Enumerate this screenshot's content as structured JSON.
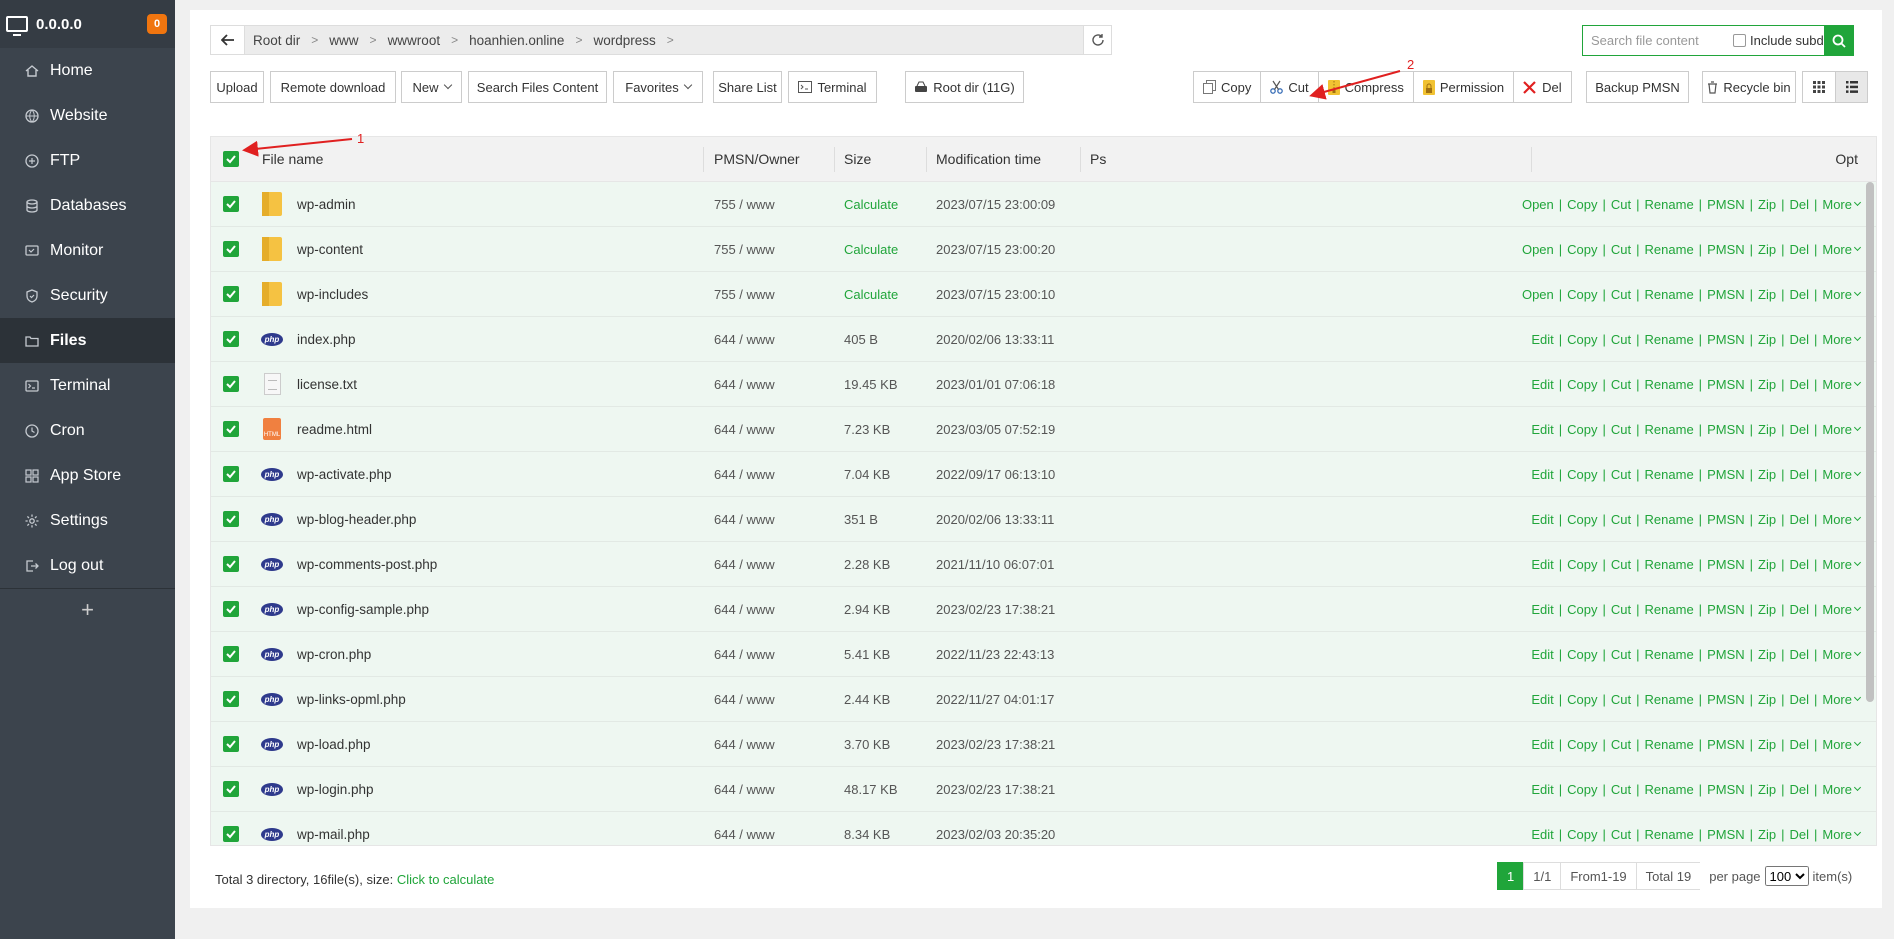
{
  "sidebar": {
    "ip": "0.0.0.0",
    "badge": "0",
    "items": [
      {
        "label": "Home",
        "icon": "home-icon"
      },
      {
        "label": "Website",
        "icon": "globe-icon"
      },
      {
        "label": "FTP",
        "icon": "ftp-icon"
      },
      {
        "label": "Databases",
        "icon": "database-icon"
      },
      {
        "label": "Monitor",
        "icon": "monitor-icon"
      },
      {
        "label": "Security",
        "icon": "shield-icon"
      },
      {
        "label": "Files",
        "icon": "folder-icon",
        "active": true
      },
      {
        "label": "Terminal",
        "icon": "terminal-icon"
      },
      {
        "label": "Cron",
        "icon": "clock-icon"
      },
      {
        "label": "App Store",
        "icon": "apps-icon"
      },
      {
        "label": "Settings",
        "icon": "gear-icon"
      },
      {
        "label": "Log out",
        "icon": "logout-icon"
      }
    ],
    "add_label": "+"
  },
  "path": {
    "crumbs": [
      "Root dir",
      "www",
      "wwwroot",
      "hoanhien.online",
      "wordpress"
    ]
  },
  "search": {
    "placeholder": "Search file content",
    "include_subdir": "Include subdir"
  },
  "toolbar": {
    "upload": "Upload",
    "remote_download": "Remote download",
    "new": "New",
    "search_files_content": "Search Files Content",
    "favorites": "Favorites",
    "share_list": "Share List",
    "terminal": "Terminal",
    "root_dir": "Root dir (11G)",
    "copy": "Copy",
    "cut": "Cut",
    "compress": "Compress",
    "permission": "Permission",
    "del": "Del",
    "backup_pmsn": "Backup PMSN",
    "recycle_bin": "Recycle bin"
  },
  "table": {
    "headers": {
      "name": "File name",
      "owner": "PMSN/Owner",
      "size": "Size",
      "mtime": "Modification time",
      "ps": "Ps",
      "opt": "Opt"
    },
    "rows": [
      {
        "name": "wp-admin",
        "type": "folder",
        "perm": "755 / www",
        "size": "Calculate",
        "mtime": "2023/07/15 23:00:09"
      },
      {
        "name": "wp-content",
        "type": "folder",
        "perm": "755 / www",
        "size": "Calculate",
        "mtime": "2023/07/15 23:00:20"
      },
      {
        "name": "wp-includes",
        "type": "folder",
        "perm": "755 / www",
        "size": "Calculate",
        "mtime": "2023/07/15 23:00:10"
      },
      {
        "name": "index.php",
        "type": "php",
        "perm": "644 / www",
        "size": "405 B",
        "mtime": "2020/02/06 13:33:11"
      },
      {
        "name": "license.txt",
        "type": "txt",
        "perm": "644 / www",
        "size": "19.45 KB",
        "mtime": "2023/01/01 07:06:18"
      },
      {
        "name": "readme.html",
        "type": "html",
        "perm": "644 / www",
        "size": "7.23 KB",
        "mtime": "2023/03/05 07:52:19"
      },
      {
        "name": "wp-activate.php",
        "type": "php",
        "perm": "644 / www",
        "size": "7.04 KB",
        "mtime": "2022/09/17 06:13:10"
      },
      {
        "name": "wp-blog-header.php",
        "type": "php",
        "perm": "644 / www",
        "size": "351 B",
        "mtime": "2020/02/06 13:33:11"
      },
      {
        "name": "wp-comments-post.php",
        "type": "php",
        "perm": "644 / www",
        "size": "2.28 KB",
        "mtime": "2021/11/10 06:07:01"
      },
      {
        "name": "wp-config-sample.php",
        "type": "php",
        "perm": "644 / www",
        "size": "2.94 KB",
        "mtime": "2023/02/23 17:38:21"
      },
      {
        "name": "wp-cron.php",
        "type": "php",
        "perm": "644 / www",
        "size": "5.41 KB",
        "mtime": "2022/11/23 22:43:13"
      },
      {
        "name": "wp-links-opml.php",
        "type": "php",
        "perm": "644 / www",
        "size": "2.44 KB",
        "mtime": "2022/11/27 04:01:17"
      },
      {
        "name": "wp-load.php",
        "type": "php",
        "perm": "644 / www",
        "size": "3.70 KB",
        "mtime": "2023/02/23 17:38:21"
      },
      {
        "name": "wp-login.php",
        "type": "php",
        "perm": "644 / www",
        "size": "48.17 KB",
        "mtime": "2023/02/23 17:38:21"
      },
      {
        "name": "wp-mail.php",
        "type": "php",
        "perm": "644 / www",
        "size": "8.34 KB",
        "mtime": "2023/02/03 20:35:20"
      }
    ],
    "folder_ops": [
      "Open",
      "Copy",
      "Cut",
      "Rename",
      "PMSN",
      "Zip",
      "Del",
      "More"
    ],
    "file_ops": [
      "Edit",
      "Copy",
      "Cut",
      "Rename",
      "PMSN",
      "Zip",
      "Del",
      "More"
    ],
    "php_label": "php",
    "html_label": "HTML"
  },
  "footer": {
    "summary": "Total 3 directory, 16file(s), size: ",
    "calc_link": "Click to calculate",
    "page_current": "1",
    "page_total": "1/1",
    "range": "From1-19",
    "total": "Total 19",
    "per_page": "per page",
    "per_page_value": "100",
    "items_suffix": "item(s)"
  },
  "annotations": {
    "label_1": "1",
    "label_2": "2",
    "color": "#e02020"
  },
  "colors": {
    "accent": "#20a53a",
    "sidebar_bg": "#3c444d",
    "row_bg": "#eef7f1",
    "badge": "#f0750f"
  }
}
